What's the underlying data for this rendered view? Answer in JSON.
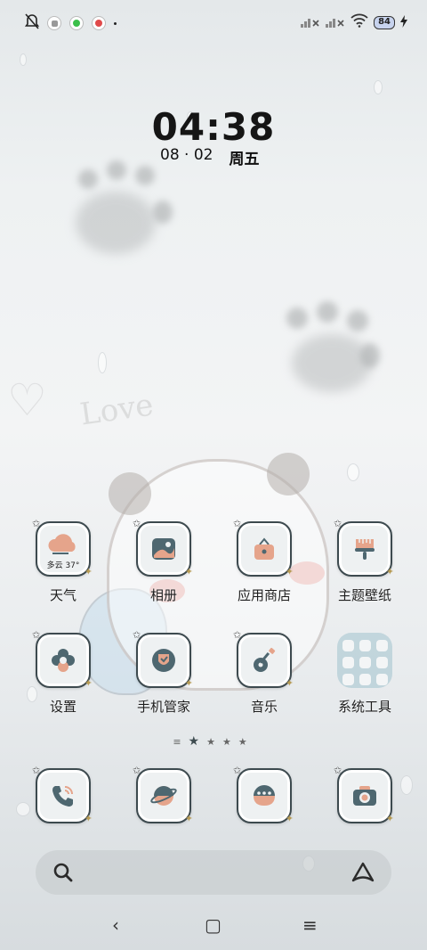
{
  "status_bar": {
    "battery_level": "84",
    "notification_icons": [
      "mute-bell-icon",
      "app-notification-icon",
      "green-app-icon",
      "red-app-icon"
    ],
    "right_icons": [
      "signal-no-service-icon",
      "signal-no-service-icon",
      "wifi-icon",
      "battery-icon",
      "charging-icon"
    ]
  },
  "clock": {
    "time": "04:38",
    "date": "08 · 02",
    "weekday": "周五"
  },
  "apps": [
    {
      "label": "天气",
      "icon": "weather-cloud-icon",
      "sub": "多云 37°"
    },
    {
      "label": "相册",
      "icon": "gallery-icon"
    },
    {
      "label": "应用商店",
      "icon": "app-store-bag-icon"
    },
    {
      "label": "主题壁纸",
      "icon": "theme-brush-icon"
    },
    {
      "label": "设置",
      "icon": "settings-flower-icon"
    },
    {
      "label": "手机管家",
      "icon": "security-shield-icon"
    },
    {
      "label": "音乐",
      "icon": "guitar-icon"
    },
    {
      "label": "系统工具",
      "icon": "folder-icon"
    }
  ],
  "dock": [
    {
      "icon": "phone-icon"
    },
    {
      "icon": "browser-planet-icon"
    },
    {
      "icon": "messages-icon"
    },
    {
      "icon": "camera-icon"
    }
  ],
  "pager": {
    "current": 1,
    "total": 5
  },
  "search_bar": {
    "left_icon": "search-icon",
    "right_icon": "assistant-icon"
  },
  "nav": {
    "back": "‹",
    "home": "▢",
    "menu": "≡"
  },
  "colors": {
    "icon_border": "#3d4a4f",
    "accent_peach": "#e5a48b",
    "accent_teal": "#4e6770",
    "folder": "#a0c3cd"
  }
}
